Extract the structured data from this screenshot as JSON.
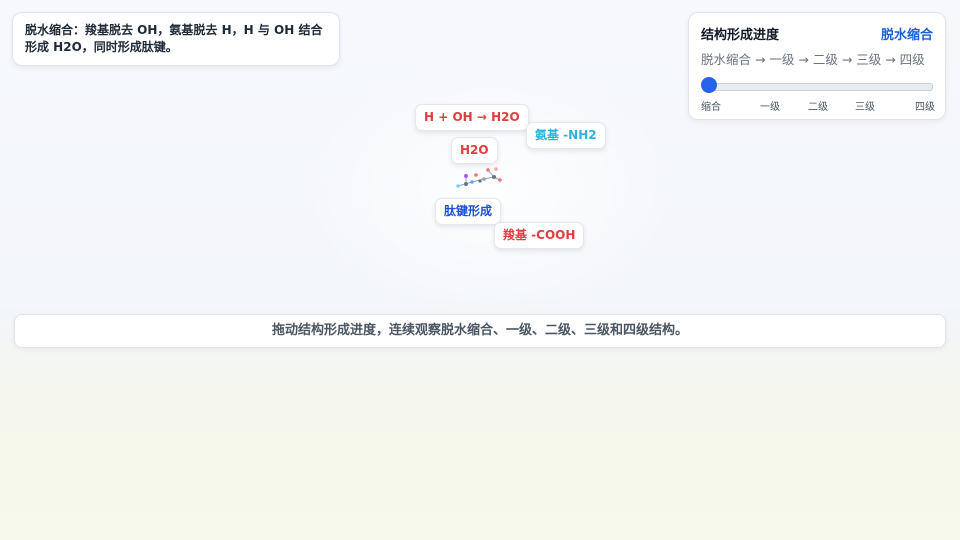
{
  "description": "脱水缩合：羧基脱去 OH，氨基脱去 H，H 与 OH 结合形成 H2O，同时形成肽键。",
  "progress": {
    "title": "结构形成进度",
    "current_stage": "脱水缩合",
    "sequence": "脱水缩合 → 一级 → 二级 → 三级 → 四级",
    "value": 0,
    "ticks": [
      "缩合",
      "一级",
      "二级",
      "三级",
      "四级"
    ]
  },
  "labels": {
    "reaction": "H + OH → H2O",
    "amino": "氨基 -NH2",
    "water": "H2O",
    "peptide": "肽键形成",
    "carboxyl": "羧基 -COOH"
  },
  "hint": "拖动结构形成进度，连续观察脱水缩合、一级、二级、三级和四级结构。",
  "colors": {
    "accent": "#2563eb",
    "red": "#e03e3e",
    "cyan": "#2bb3d9",
    "blue": "#1d4ed8"
  }
}
